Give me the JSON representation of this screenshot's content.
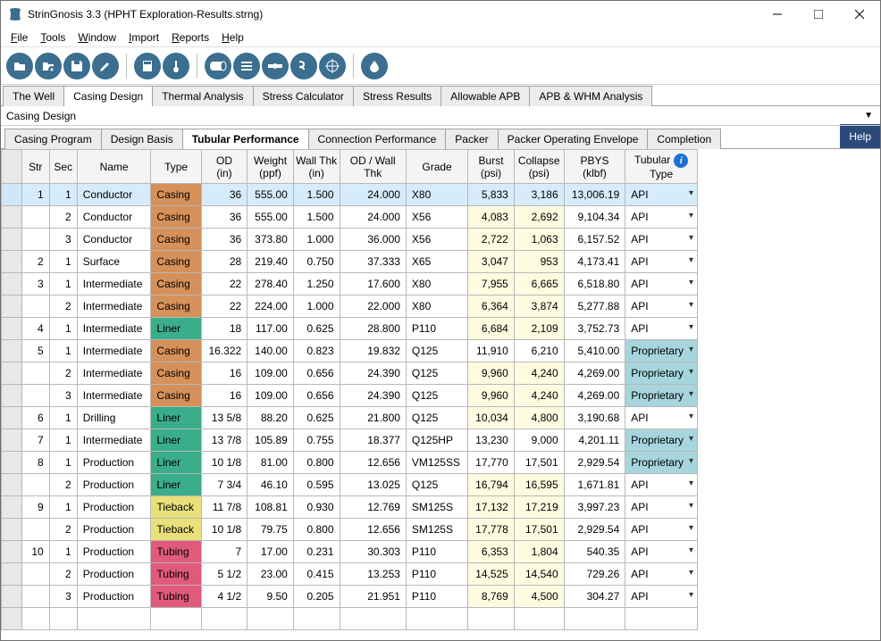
{
  "window": {
    "title": "StrinGnosis 3.3 (HPHT Exploration-Results.strng)"
  },
  "menu": [
    "File",
    "Tools",
    "Window",
    "Import",
    "Reports",
    "Help"
  ],
  "maintabs": [
    "The Well",
    "Casing Design",
    "Thermal Analysis",
    "Stress Calculator",
    "Stress Results",
    "Allowable APB",
    "APB & WHM Analysis"
  ],
  "maintab_active": 1,
  "crumb": "Casing Design",
  "subtabs": [
    "Casing Program",
    "Design Basis",
    "Tubular Performance",
    "Connection Performance",
    "Packer",
    "Packer Operating Envelope",
    "Completion"
  ],
  "subtab_active": 2,
  "help_label": "Help",
  "columns": [
    {
      "h1": "Str",
      "h2": ""
    },
    {
      "h1": "Sec",
      "h2": ""
    },
    {
      "h1": "Name",
      "h2": ""
    },
    {
      "h1": "Type",
      "h2": ""
    },
    {
      "h1": "OD",
      "h2": "(in)"
    },
    {
      "h1": "Weight",
      "h2": "(ppf)"
    },
    {
      "h1": "Wall Thk",
      "h2": "(in)"
    },
    {
      "h1": "OD / Wall Thk",
      "h2": ""
    },
    {
      "h1": "Grade",
      "h2": ""
    },
    {
      "h1": "Burst",
      "h2": "(psi)"
    },
    {
      "h1": "Collapse",
      "h2": "(psi)"
    },
    {
      "h1": "PBYS",
      "h2": "(klbf)"
    },
    {
      "h1": "Tubular",
      "h2": "Type"
    }
  ],
  "rows": [
    {
      "str": "1",
      "sec": "1",
      "name": "Conductor",
      "type": "Casing",
      "od": "36",
      "wt": "555.00",
      "thk": "1.500",
      "ratio": "24.000",
      "grade": "X80",
      "burst": "5,833",
      "collapse": "3,186",
      "pbys": "13,006.19",
      "tt": "API",
      "sel": true,
      "hi": false
    },
    {
      "str": "",
      "sec": "2",
      "name": "Conductor",
      "type": "Casing",
      "od": "36",
      "wt": "555.00",
      "thk": "1.500",
      "ratio": "24.000",
      "grade": "X56",
      "burst": "4,083",
      "collapse": "2,692",
      "pbys": "9,104.34",
      "tt": "API",
      "hi": true
    },
    {
      "str": "",
      "sec": "3",
      "name": "Conductor",
      "type": "Casing",
      "od": "36",
      "wt": "373.80",
      "thk": "1.000",
      "ratio": "36.000",
      "grade": "X56",
      "burst": "2,722",
      "collapse": "1,063",
      "pbys": "6,157.52",
      "tt": "API",
      "hi": true
    },
    {
      "str": "2",
      "sec": "1",
      "name": "Surface",
      "type": "Casing",
      "od": "28",
      "wt": "219.40",
      "thk": "0.750",
      "ratio": "37.333",
      "grade": "X65",
      "burst": "3,047",
      "collapse": "953",
      "pbys": "4,173.41",
      "tt": "API",
      "hi": true
    },
    {
      "str": "3",
      "sec": "1",
      "name": "Intermediate",
      "type": "Casing",
      "od": "22",
      "wt": "278.40",
      "thk": "1.250",
      "ratio": "17.600",
      "grade": "X80",
      "burst": "7,955",
      "collapse": "6,665",
      "pbys": "6,518.80",
      "tt": "API",
      "hi": true
    },
    {
      "str": "",
      "sec": "2",
      "name": "Intermediate",
      "type": "Casing",
      "od": "22",
      "wt": "224.00",
      "thk": "1.000",
      "ratio": "22.000",
      "grade": "X80",
      "burst": "6,364",
      "collapse": "3,874",
      "pbys": "5,277.88",
      "tt": "API",
      "hi": true
    },
    {
      "str": "4",
      "sec": "1",
      "name": "Intermediate",
      "type": "Liner",
      "od": "18",
      "wt": "117.00",
      "thk": "0.625",
      "ratio": "28.800",
      "grade": "P110",
      "burst": "6,684",
      "collapse": "2,109",
      "pbys": "3,752.73",
      "tt": "API",
      "hi": true
    },
    {
      "str": "5",
      "sec": "1",
      "name": "Intermediate",
      "type": "Casing",
      "od": "16.322",
      "wt": "140.00",
      "thk": "0.823",
      "ratio": "19.832",
      "grade": "Q125",
      "burst": "11,910",
      "collapse": "6,210",
      "pbys": "5,410.00",
      "tt": "Proprietary",
      "prop": true,
      "hi": false
    },
    {
      "str": "",
      "sec": "2",
      "name": "Intermediate",
      "type": "Casing",
      "od": "16",
      "wt": "109.00",
      "thk": "0.656",
      "ratio": "24.390",
      "grade": "Q125",
      "burst": "9,960",
      "collapse": "4,240",
      "pbys": "4,269.00",
      "tt": "Proprietary",
      "prop": true,
      "hi": true
    },
    {
      "str": "",
      "sec": "3",
      "name": "Intermediate",
      "type": "Casing",
      "od": "16",
      "wt": "109.00",
      "thk": "0.656",
      "ratio": "24.390",
      "grade": "Q125",
      "burst": "9,960",
      "collapse": "4,240",
      "pbys": "4,269.00",
      "tt": "Proprietary",
      "prop": true,
      "hi": true
    },
    {
      "str": "6",
      "sec": "1",
      "name": "Drilling",
      "type": "Liner",
      "od": "13 5/8",
      "wt": "88.20",
      "thk": "0.625",
      "ratio": "21.800",
      "grade": "Q125",
      "burst": "10,034",
      "collapse": "4,800",
      "pbys": "3,190.68",
      "tt": "API",
      "hi": true
    },
    {
      "str": "7",
      "sec": "1",
      "name": "Intermediate",
      "type": "Liner",
      "od": "13 7/8",
      "wt": "105.89",
      "thk": "0.755",
      "ratio": "18.377",
      "grade": "Q125HP",
      "burst": "13,230",
      "collapse": "9,000",
      "pbys": "4,201.11",
      "tt": "Proprietary",
      "prop": true,
      "hi": false
    },
    {
      "str": "8",
      "sec": "1",
      "name": "Production",
      "type": "Liner",
      "od": "10 1/8",
      "wt": "81.00",
      "thk": "0.800",
      "ratio": "12.656",
      "grade": "VM125SS",
      "burst": "17,770",
      "collapse": "17,501",
      "pbys": "2,929.54",
      "tt": "Proprietary",
      "prop": true,
      "hi": false
    },
    {
      "str": "",
      "sec": "2",
      "name": "Production",
      "type": "Liner",
      "od": "7 3/4",
      "wt": "46.10",
      "thk": "0.595",
      "ratio": "13.025",
      "grade": "Q125",
      "burst": "16,794",
      "collapse": "16,595",
      "pbys": "1,671.81",
      "tt": "API",
      "hi": true
    },
    {
      "str": "9",
      "sec": "1",
      "name": "Production",
      "type": "Tieback",
      "od": "11 7/8",
      "wt": "108.81",
      "thk": "0.930",
      "ratio": "12.769",
      "grade": "SM125S",
      "burst": "17,132",
      "collapse": "17,219",
      "pbys": "3,997.23",
      "tt": "API",
      "hi": true
    },
    {
      "str": "",
      "sec": "2",
      "name": "Production",
      "type": "Tieback",
      "od": "10 1/8",
      "wt": "79.75",
      "thk": "0.800",
      "ratio": "12.656",
      "grade": "SM125S",
      "burst": "17,778",
      "collapse": "17,501",
      "pbys": "2,929.54",
      "tt": "API",
      "hi": true
    },
    {
      "str": "10",
      "sec": "1",
      "name": "Production",
      "type": "Tubing",
      "od": "7",
      "wt": "17.00",
      "thk": "0.231",
      "ratio": "30.303",
      "grade": "P110",
      "burst": "6,353",
      "collapse": "1,804",
      "pbys": "540.35",
      "tt": "API",
      "hi": true
    },
    {
      "str": "",
      "sec": "2",
      "name": "Production",
      "type": "Tubing",
      "od": "5 1/2",
      "wt": "23.00",
      "thk": "0.415",
      "ratio": "13.253",
      "grade": "P110",
      "burst": "14,525",
      "collapse": "14,540",
      "pbys": "729.26",
      "tt": "API",
      "hi": true
    },
    {
      "str": "",
      "sec": "3",
      "name": "Production",
      "type": "Tubing",
      "od": "4 1/2",
      "wt": "9.50",
      "thk": "0.205",
      "ratio": "21.951",
      "grade": "P110",
      "burst": "8,769",
      "collapse": "4,500",
      "pbys": "304.27",
      "tt": "API",
      "hi": true
    }
  ]
}
